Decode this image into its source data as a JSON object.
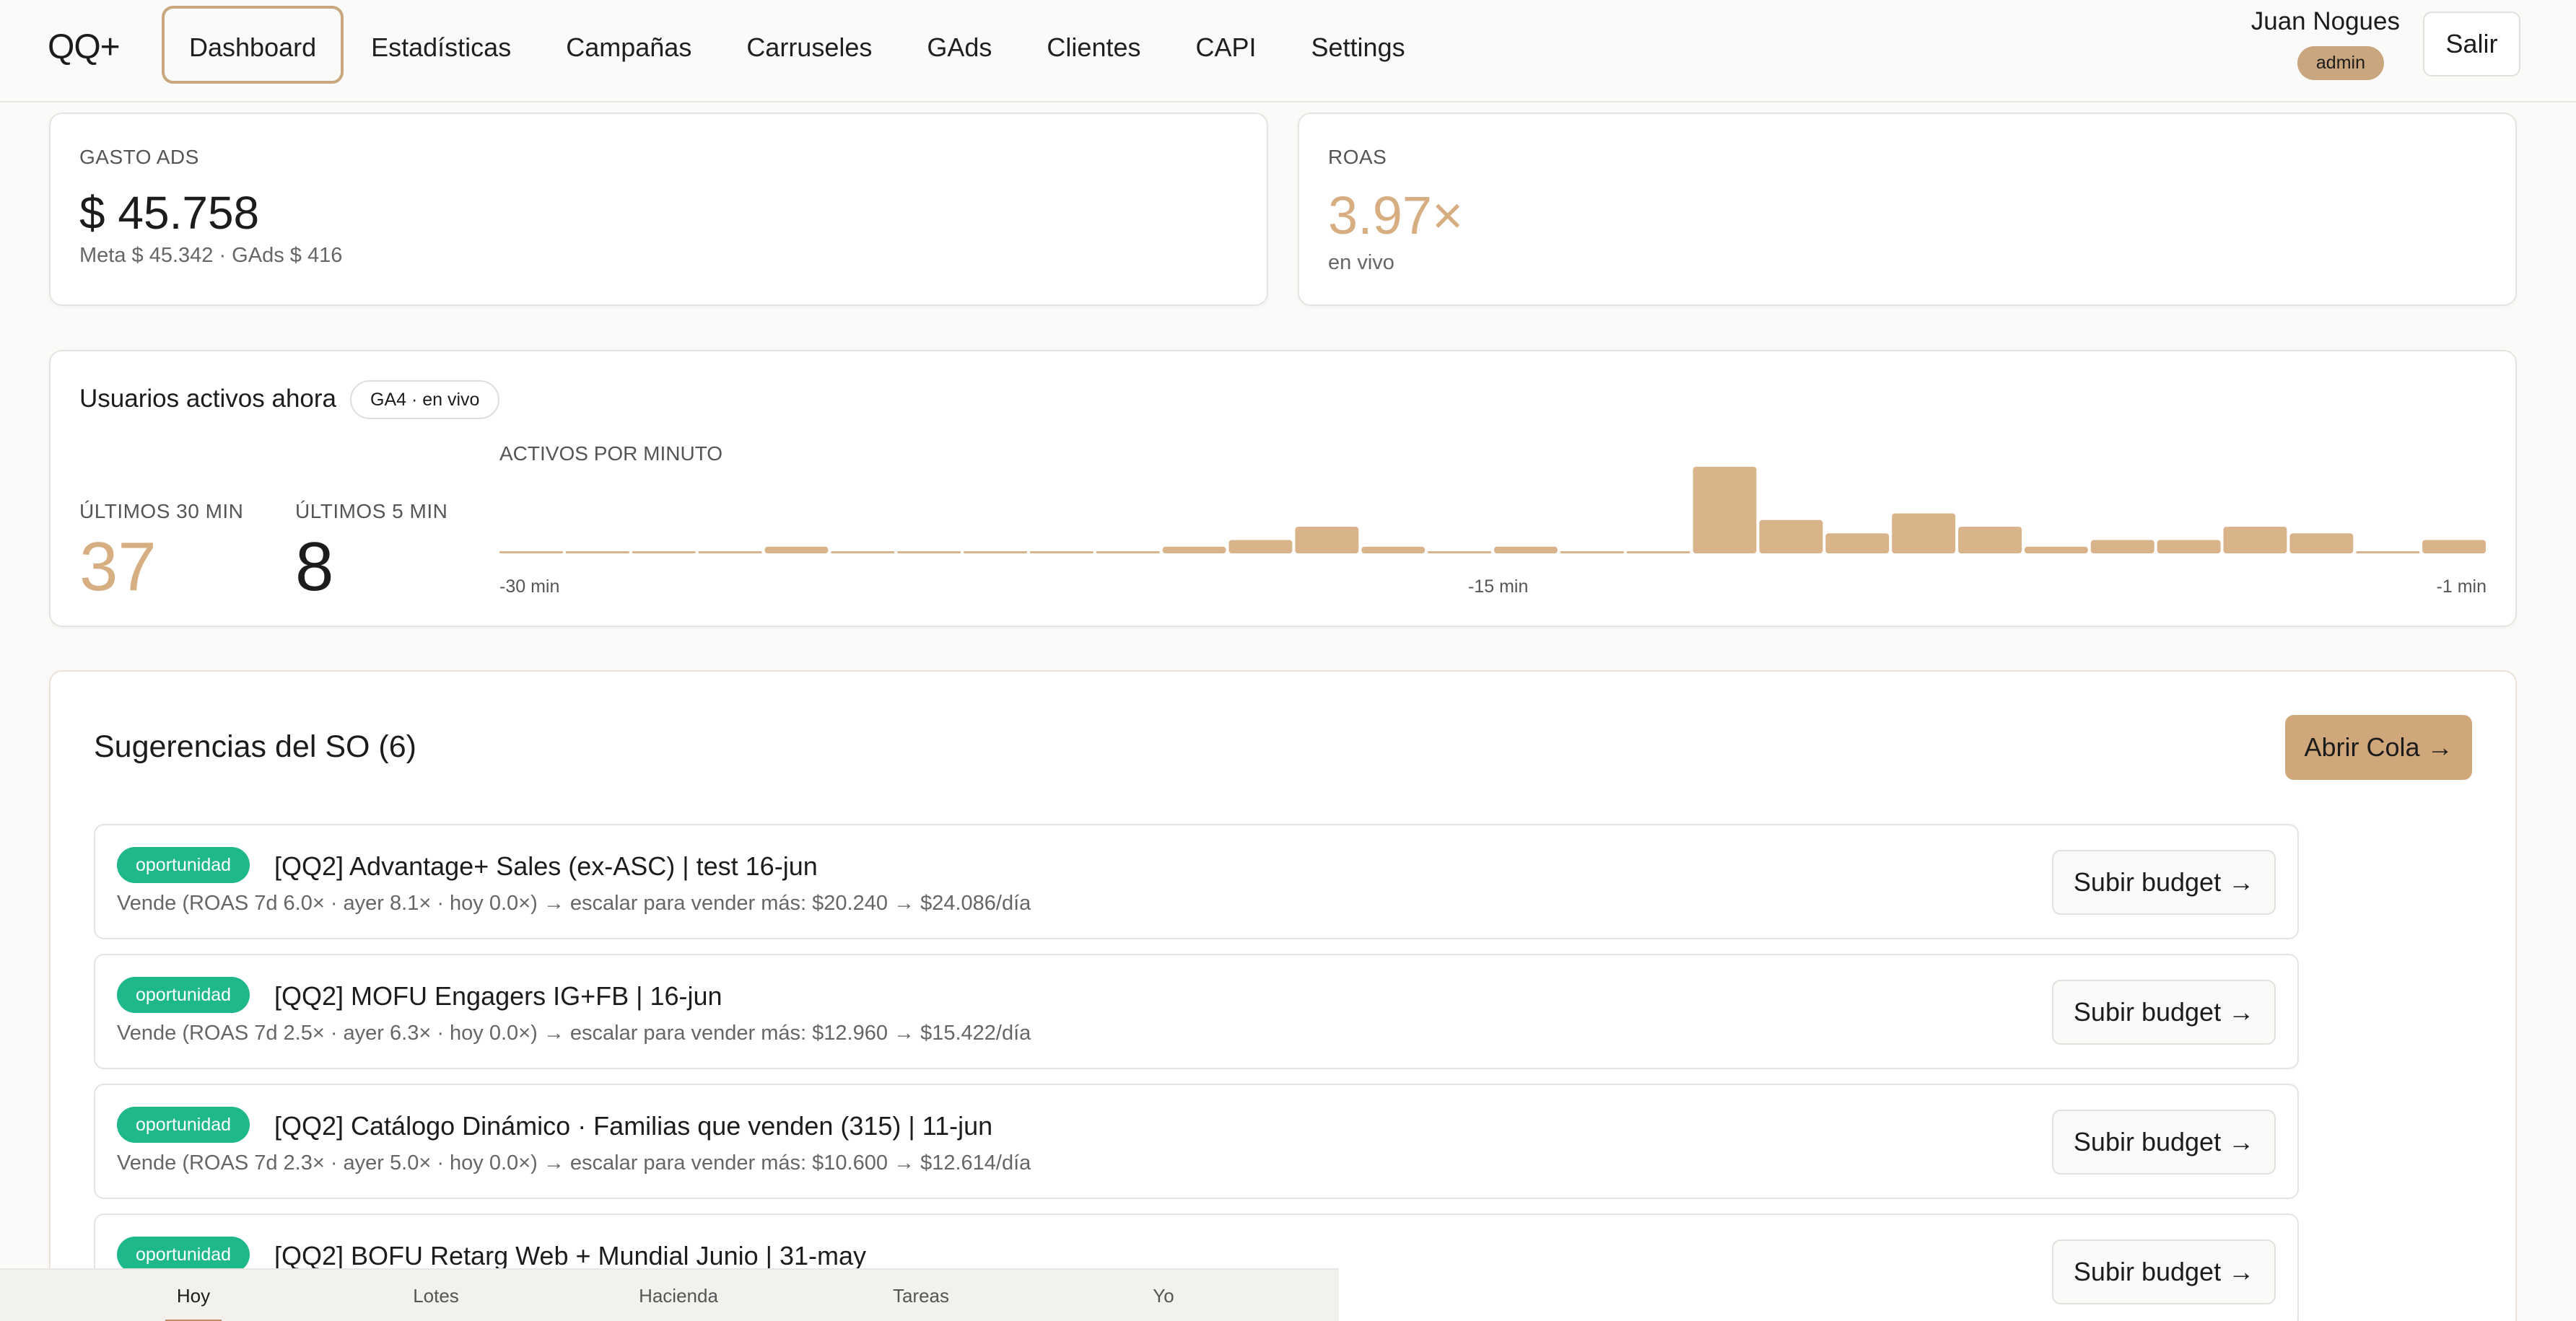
{
  "nav": {
    "brand": "QQ+",
    "tabs": [
      "Dashboard",
      "Estadísticas",
      "Campañas",
      "Carruseles",
      "GAds",
      "Clientes",
      "CAPI",
      "Settings"
    ],
    "active_tab": "Dashboard",
    "user_name": "Juan Nogues",
    "role": "admin",
    "logout": "Salir"
  },
  "kpis": {
    "ads_spend": {
      "label": "GASTO ADS",
      "value": "$ 45.758",
      "sub": "Meta $ 45.342 · GAds $ 416"
    },
    "roas": {
      "label": "ROAS",
      "value": "3.97×",
      "sub": "en vivo"
    }
  },
  "active_users": {
    "title": "Usuarios activos ahora",
    "pill": "GA4 · en vivo",
    "last30": {
      "label": "ÚLTIMOS 30 MIN",
      "value": "37"
    },
    "last5": {
      "label": "ÚLTIMOS 5 MIN",
      "value": "8"
    },
    "chart_title": "ACTIVOS POR MINUTO",
    "axis": {
      "start": "-30 min",
      "mid": "-15 min",
      "end": "-1 min"
    }
  },
  "chart_data": {
    "type": "bar",
    "title": "ACTIVOS POR MINUTO",
    "categories": [
      "-30 min",
      "-29",
      "-28",
      "-27",
      "-26",
      "-25",
      "-24",
      "-23",
      "-22",
      "-21",
      "-20",
      "-19",
      "-18",
      "-17",
      "-16",
      "-15 min",
      "-14",
      "-13",
      "-12",
      "-11",
      "-10",
      "-9",
      "-8",
      "-7",
      "-6",
      "-5",
      "-4",
      "-3",
      "-2",
      "-1 min"
    ],
    "values": [
      0,
      0,
      0,
      0,
      1,
      0,
      0,
      0,
      0,
      0,
      1,
      2,
      4,
      1,
      0,
      1,
      0,
      0,
      13,
      5,
      3,
      6,
      4,
      1,
      2,
      2,
      4,
      3,
      0,
      2
    ],
    "xlabel": "",
    "ylabel": "",
    "color": "#d9b48a"
  },
  "suggestions": {
    "title": "Sugerencias del SO (6)",
    "open_queue": "Abrir Cola →",
    "items": [
      {
        "tag": "oportunidad",
        "title": "[QQ2] Advantage+ Sales (ex-ASC) | test 16-jun",
        "desc": "Vende (ROAS 7d 6.0× · ayer 8.1× · hoy 0.0×) → escalar para vender más: $20.240 → $24.086/día",
        "action": "Subir budget →"
      },
      {
        "tag": "oportunidad",
        "title": "[QQ2] MOFU Engagers IG+FB | 16-jun",
        "desc": "Vende (ROAS 7d 2.5× · ayer 6.3× · hoy 0.0×) → escalar para vender más: $12.960 → $15.422/día",
        "action": "Subir budget →"
      },
      {
        "tag": "oportunidad",
        "title": "[QQ2] Catálogo Dinámico · Familias que venden (315) | 11-jun",
        "desc": "Vende (ROAS 7d 2.3× · ayer 5.0× · hoy 0.0×) → escalar para vender más: $10.600 → $12.614/día",
        "action": "Subir budget →"
      },
      {
        "tag": "oportunidad",
        "title": "[QQ2] BOFU Retarg Web + Mundial Junio | 31-may",
        "desc": "",
        "action": "Subir budget →"
      }
    ]
  },
  "bottom_tabs": [
    "Hoy",
    "Lotes",
    "Hacienda",
    "Tareas",
    "Yo"
  ],
  "bottom_active": "Hoy",
  "colors": {
    "accent": "#c9a67d",
    "tag_green": "#1fb88a",
    "bar": "#d9b48a"
  }
}
